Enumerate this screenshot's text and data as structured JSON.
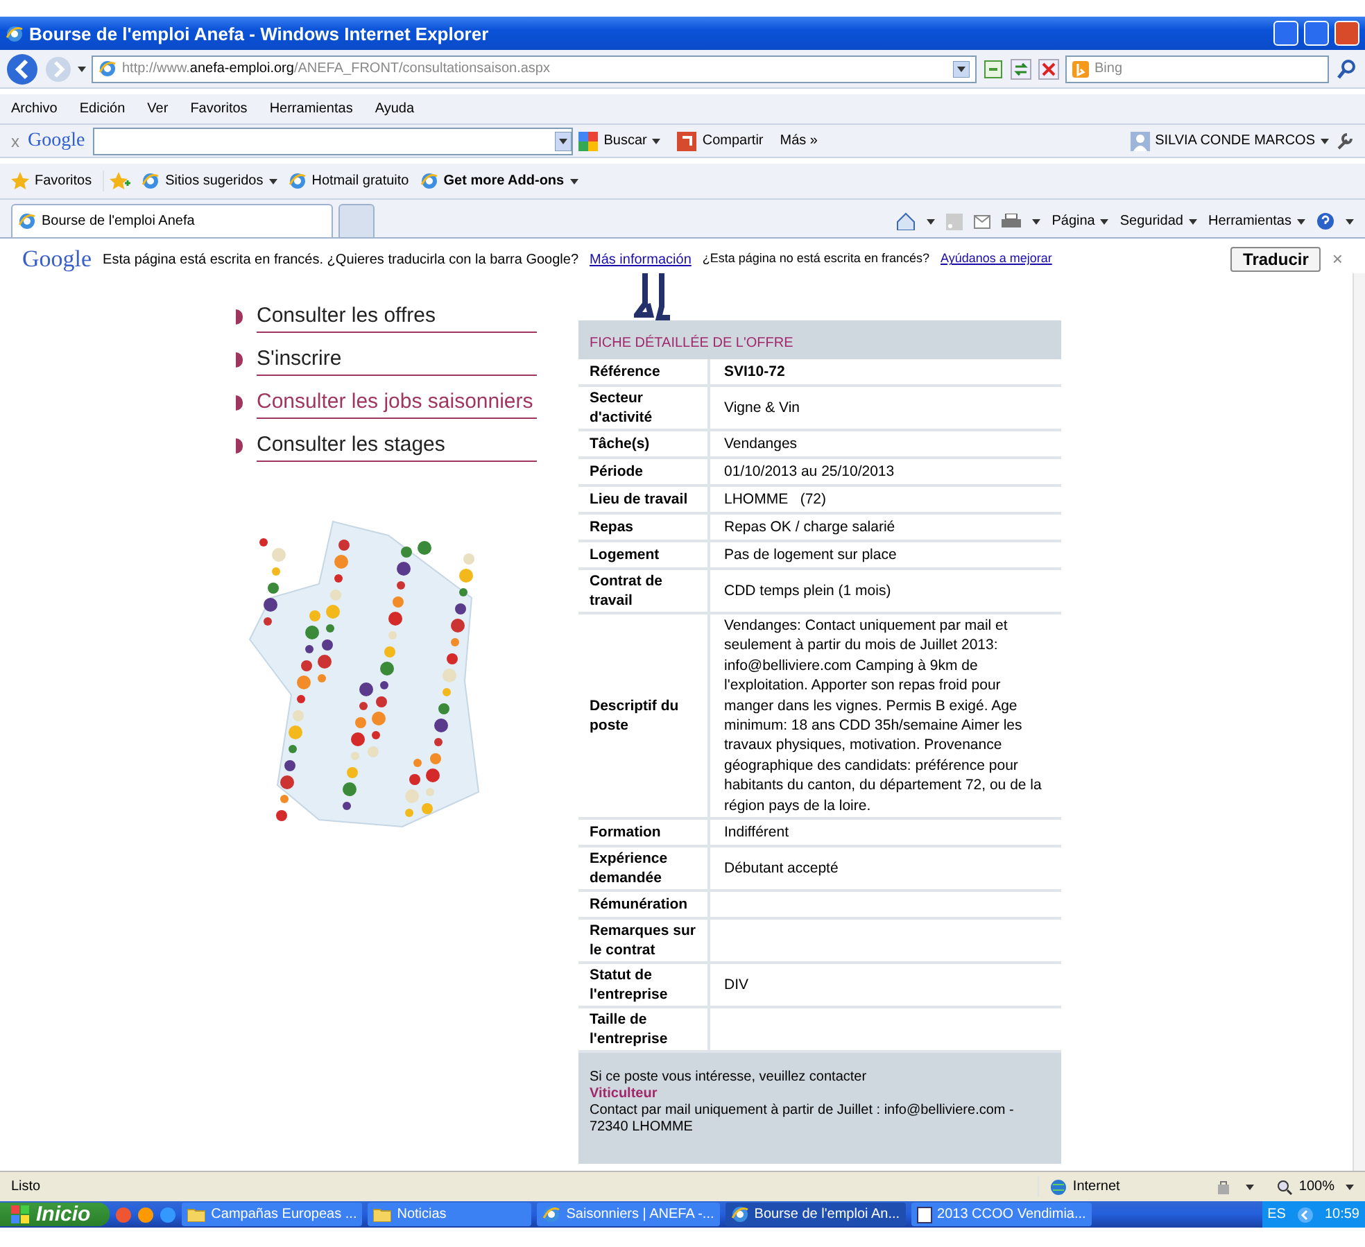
{
  "window": {
    "title": "Bourse de l'emploi Anefa - Windows Internet Explorer"
  },
  "address_bar": {
    "url_prefix": "http://www.",
    "domain": "anefa-emploi.org",
    "url_path": "/ANEFA_FRONT/consultationsaison.aspx",
    "search_placeholder": "Bing"
  },
  "menu_bar": [
    "Archivo",
    "Edición",
    "Ver",
    "Favoritos",
    "Herramientas",
    "Ayuda"
  ],
  "google_toolbar": {
    "close": "x",
    "logo": "Google",
    "buttons": [
      "Buscar",
      "Compartir"
    ],
    "more": "Más »",
    "user": "SILVIA CONDE MARCOS"
  },
  "favorites_bar": {
    "favorites": "Favoritos",
    "links": [
      {
        "label": "Sitios sugeridos",
        "bold": false,
        "dropdown": true
      },
      {
        "label": "Hotmail gratuito",
        "bold": false,
        "dropdown": false
      },
      {
        "label": "Get more Add-ons",
        "bold": true,
        "dropdown": true
      }
    ]
  },
  "tabs": [
    {
      "label": "Bourse de l'emploi Anefa",
      "selected": true
    }
  ],
  "command_bar": [
    "Página",
    "Seguridad",
    "Herramientas"
  ],
  "translate_bar": {
    "logo": "Google",
    "message": "Esta página está escrita en francés. ¿Quieres traducirla con la barra Google?",
    "link": "Más información",
    "question": "¿Esta página no está escrita en francés?",
    "help_link": "Ayúdanos a mejorar",
    "button": "Traducir",
    "close": "×"
  },
  "page": {
    "nav": [
      {
        "label": "Consulter les offres",
        "selected": false
      },
      {
        "label": "S'inscrire",
        "selected": false
      },
      {
        "label": "Consulter les jobs saisonniers",
        "selected": true
      },
      {
        "label": "Consulter les stages",
        "selected": false
      }
    ],
    "offer": {
      "heading": "FICHE DÉTAILLÉE DE L'OFFRE",
      "rows": [
        {
          "label": "Référence",
          "value": "SVI10-72",
          "bold": true
        },
        {
          "label": "Secteur d'activité",
          "value": "Vigne & Vin",
          "bold": false
        },
        {
          "label": "Tâche(s)",
          "value": "Vendanges",
          "bold": false
        },
        {
          "label": "Période",
          "value": "01/10/2013 au 25/10/2013",
          "bold": false
        },
        {
          "label": "Lieu de travail",
          "value": "LHOMME   (72)",
          "bold": false
        },
        {
          "label": "Repas",
          "value": "Repas OK / charge salarié",
          "bold": false
        },
        {
          "label": "Logement",
          "value": "Pas de logement sur place",
          "bold": false
        },
        {
          "label": "Contrat de travail",
          "value": "CDD temps plein (1 mois)",
          "bold": false
        },
        {
          "label": "Descriptif du poste",
          "value": "Vendanges: Contact uniquement par mail et seulement à partir du mois de Juillet 2013: info@belliviere.com Camping à 9km de l'exploitation. Apporter son repas froid pour manger dans les vignes. Permis B exigé. Age minimum: 18 ans CDD 35h/semaine Aimer les travaux physiques, motivation. Provenance géographique des candidats: préférence pour habitants du canton, du département 72, ou de la région pays de la loire.",
          "bold": false
        },
        {
          "label": "Formation",
          "value": "Indifférent",
          "bold": false
        },
        {
          "label": "Expérience demandée",
          "value": "Débutant accepté",
          "bold": false
        },
        {
          "label": "Rémunération"
        },
        {
          "label": "Remarques sur le contrat"
        },
        {
          "label": "Statut de l'entreprise",
          "value": "DIV",
          "bold": false
        },
        {
          "label": "Taille de l'entreprise"
        }
      ],
      "contact": {
        "intro": "Si ce poste vous intéresse, veuillez contacter",
        "name": "Viticulteur",
        "details": "Contact par mail uniquement à partir de Juillet : info@belliviere.com - 72340 LHOMME"
      }
    }
  },
  "status_bar": {
    "text": "Listo",
    "zone": "Internet",
    "zoom": "100%"
  },
  "taskbar": {
    "start": "Inicio",
    "items": [
      {
        "label": "Campañas Europeas ...",
        "kind": "folder",
        "selected": false
      },
      {
        "label": "Noticias",
        "kind": "folder",
        "selected": false
      },
      {
        "label": "Saisonniers | ANEFA -...",
        "kind": "browser",
        "selected": false
      },
      {
        "label": "Bourse de l'emploi An...",
        "kind": "browser",
        "selected": true
      },
      {
        "label": "2013 CCOO Vendimia...",
        "kind": "document",
        "selected": false
      }
    ],
    "language": "ES",
    "clock": "10:59"
  }
}
